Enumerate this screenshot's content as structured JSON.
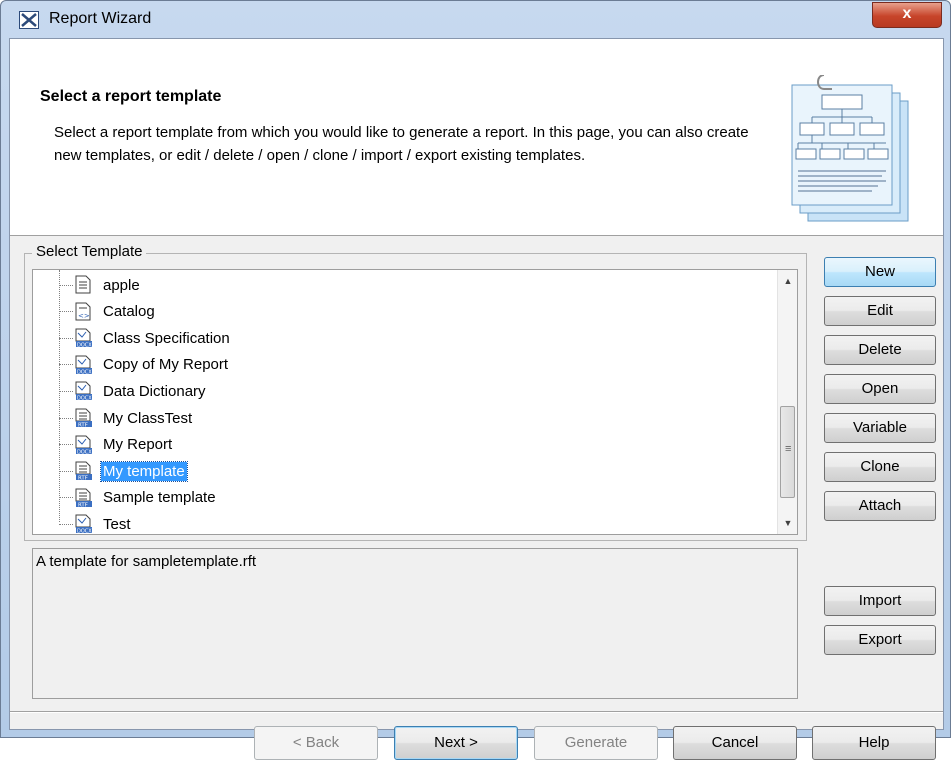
{
  "window": {
    "title": "Report Wizard",
    "close_label": "x"
  },
  "header": {
    "title": "Select a report template",
    "description": "Select a report template from which you would like to generate a report. In this page, you can also create new templates, or edit / delete / open / clone / import / export existing templates."
  },
  "group": {
    "label": "Select Template"
  },
  "templates": [
    {
      "label": "apple",
      "icon": "document-icon",
      "selected": false
    },
    {
      "label": "Catalog",
      "icon": "xml-document-icon",
      "selected": false
    },
    {
      "label": "Class Specification",
      "icon": "docx-template-icon",
      "selected": false
    },
    {
      "label": "Copy of My Report",
      "icon": "docx-template-icon",
      "selected": false
    },
    {
      "label": "Data Dictionary",
      "icon": "docx-template-icon",
      "selected": false
    },
    {
      "label": "My ClassTest",
      "icon": "rtf-document-icon",
      "selected": false
    },
    {
      "label": "My Report",
      "icon": "docx-template-icon",
      "selected": false
    },
    {
      "label": "My template",
      "icon": "rtf-document-icon",
      "selected": true
    },
    {
      "label": "Sample template",
      "icon": "rtf-document-icon",
      "selected": false
    },
    {
      "label": "Test",
      "icon": "docx-template-icon",
      "selected": false
    }
  ],
  "description_text": "A template for sampletemplate.rft",
  "side_buttons": {
    "new": "New",
    "edit": "Edit",
    "delete": "Delete",
    "open": "Open",
    "variable": "Variable",
    "clone": "Clone",
    "attach": "Attach",
    "import": "Import",
    "export": "Export"
  },
  "footer_buttons": {
    "back": "< Back",
    "next": "Next >",
    "generate": "Generate",
    "cancel": "Cancel",
    "help": "Help"
  },
  "colors": {
    "selection": "#3399ff",
    "titlebar": "#c7d9ef",
    "close": "#c7442a"
  }
}
